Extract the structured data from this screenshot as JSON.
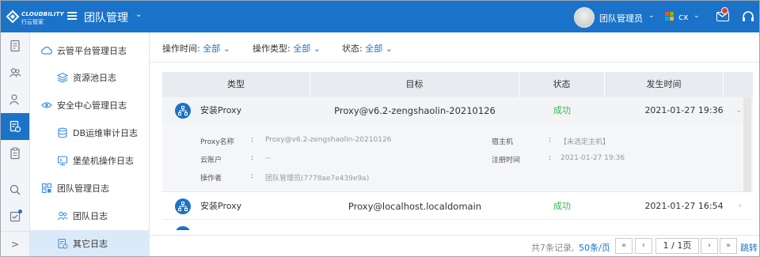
{
  "app": {
    "logo_line1": "CLOUDBILITY",
    "logo_line2": "行云管家",
    "title": "团队管理",
    "user_name": "团队管理员",
    "lang": "cx"
  },
  "rail": {
    "items": [
      {
        "name": "document-icon"
      },
      {
        "name": "users-icon"
      },
      {
        "name": "user-icon"
      },
      {
        "name": "log-icon",
        "active": true
      },
      {
        "name": "clipboard-icon"
      },
      {
        "name": "search-icon"
      },
      {
        "name": "checklist-icon"
      }
    ],
    "expand_label": ">"
  },
  "subnav": {
    "items": [
      {
        "label": "云管平台管理日志",
        "icon": "cloud-icon",
        "indent": 0
      },
      {
        "label": "资源池日志",
        "icon": "layers-icon",
        "indent": 1
      },
      {
        "label": "安全中心管理日志",
        "icon": "eye-icon",
        "indent": 0
      },
      {
        "label": "DB运维审计日志",
        "icon": "database-icon",
        "indent": 1
      },
      {
        "label": "堡垒机操作日志",
        "icon": "bastion-icon",
        "indent": 1
      },
      {
        "label": "团队管理日志",
        "icon": "grid-icon",
        "indent": 0
      },
      {
        "label": "团队日志",
        "icon": "team-icon",
        "indent": 1
      },
      {
        "label": "其它日志",
        "icon": "other-log-icon",
        "indent": 1,
        "active": true
      }
    ]
  },
  "filters": {
    "time_label": "操作时间:",
    "time_value": "全部",
    "type_label": "操作类型:",
    "type_value": "全部",
    "status_label": "状态:",
    "status_value": "全部"
  },
  "table": {
    "columns": [
      "类型",
      "目标",
      "状态",
      "发生时间"
    ],
    "rows": [
      {
        "type": "安装Proxy",
        "target": "Proxy@v6.2-zengshaolin-20210126",
        "status": "成功",
        "time": "2021-01-27 19:36",
        "expanded": true
      },
      {
        "type": "安装Proxy",
        "target": "Proxy@localhost.localdomain",
        "status": "成功",
        "time": "2021-01-27 16:54",
        "expanded": false
      }
    ],
    "detail": {
      "proxy_name_label": "Proxy名称",
      "proxy_name_value": "Proxy@v6.2-zengshaolin-20210126",
      "cloud_account_label": "云账户",
      "cloud_account_value": "--",
      "operator_label": "操作者",
      "operator_value": "团队管理员(7778ae7e439e9a)",
      "host_label": "宿主机",
      "host_value": "【未选定主机】",
      "register_time_label": "注册时间",
      "register_time_value": "2021-01-27 19:36",
      "sep": ":"
    }
  },
  "pagination": {
    "total": "共7条记录,",
    "per_page": "50条/页",
    "page": "1 / 1页",
    "jump": "跳转",
    "first": "«",
    "prev": "‹",
    "next": "›",
    "last": "»"
  },
  "colors": {
    "brand": "#1a73c8",
    "success": "#3bb54a"
  }
}
